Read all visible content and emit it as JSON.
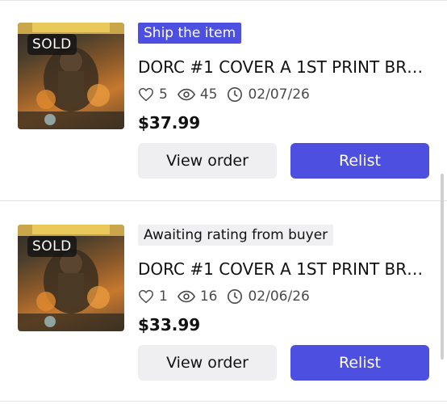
{
  "colors": {
    "accent": "#4c4fe0",
    "muted_bg": "#efeff2",
    "text": "#111111",
    "stat_text": "#4a4a4a"
  },
  "listings": [
    {
      "badge": "SOLD",
      "status": "Ship the item",
      "status_style": "primary",
      "title": "DORC #1 COVER A 1ST PRINT BR…",
      "likes": "5",
      "views": "45",
      "date": "02/07/26",
      "price": "$37.99",
      "view_label": "View order",
      "relist_label": "Relist",
      "icons": [
        "heart-icon",
        "eye-icon",
        "clock-icon"
      ]
    },
    {
      "badge": "SOLD",
      "status": "Awaiting rating from buyer",
      "status_style": "muted",
      "title": "DORC #1 COVER A 1ST PRINT BR…",
      "likes": "1",
      "views": "16",
      "date": "02/06/26",
      "price": "$33.99",
      "view_label": "View order",
      "relist_label": "Relist",
      "icons": [
        "heart-icon",
        "eye-icon",
        "clock-icon"
      ]
    }
  ]
}
